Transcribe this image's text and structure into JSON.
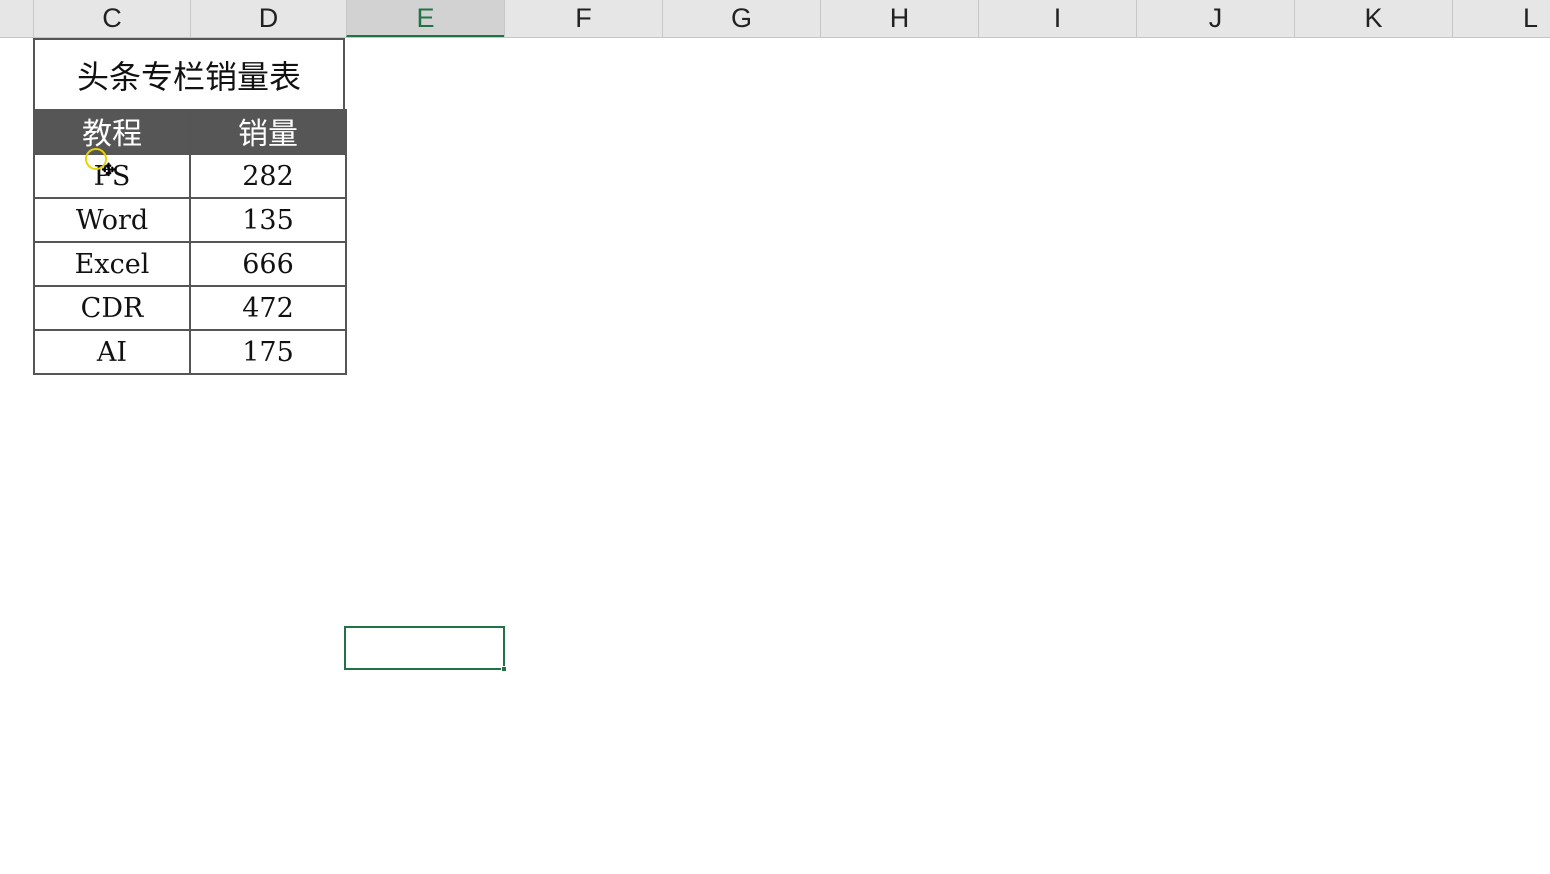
{
  "column_headers": [
    "C",
    "D",
    "E",
    "F",
    "G",
    "H",
    "I",
    "J",
    "K",
    "L"
  ],
  "active_column": "E",
  "table": {
    "title": "头条专栏销量表",
    "headers": [
      "教程",
      "销量"
    ],
    "rows": [
      {
        "course": "PS",
        "sales": "282"
      },
      {
        "course": "Word",
        "sales": "135"
      },
      {
        "course": "Excel",
        "sales": "666"
      },
      {
        "course": "CDR",
        "sales": "472"
      },
      {
        "course": "AI",
        "sales": "175"
      }
    ]
  },
  "colors": {
    "accent": "#217346",
    "header_fill": "#565656",
    "cursor_highlight": "#e6d300"
  },
  "icons": {
    "cursor": "move-cursor-icon"
  }
}
